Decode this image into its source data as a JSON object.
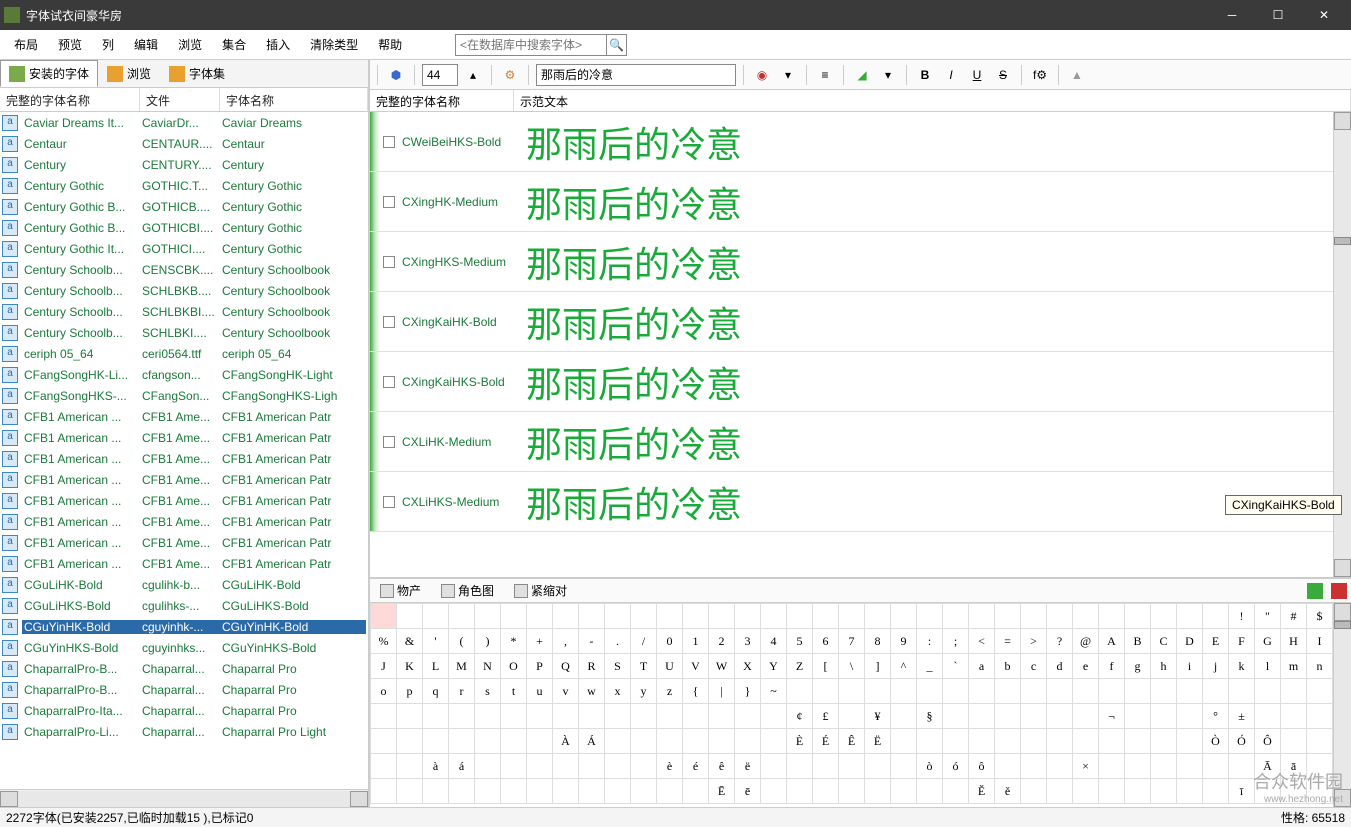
{
  "app": {
    "title": "字体试衣间豪华房"
  },
  "menu": [
    "布局",
    "预览",
    "列",
    "编辑",
    "浏览",
    "集合",
    "插入",
    "清除类型",
    "帮助"
  ],
  "search_placeholder": "<在数据库中搜索字体>",
  "left_tabs": [
    {
      "label": "安装的字体",
      "active": true
    },
    {
      "label": "浏览",
      "active": false
    },
    {
      "label": "字体集",
      "active": false
    }
  ],
  "left_headers": [
    "完整的字体名称",
    "文件",
    "字体名称"
  ],
  "font_rows": [
    {
      "name": "Caviar Dreams It...",
      "file": "CaviarDr...",
      "disp": "Caviar Dreams"
    },
    {
      "name": "Centaur",
      "file": "CENTAUR....",
      "disp": "Centaur"
    },
    {
      "name": "Century",
      "file": "CENTURY....",
      "disp": "Century"
    },
    {
      "name": "Century Gothic",
      "file": "GOTHIC.T...",
      "disp": "Century Gothic"
    },
    {
      "name": "Century Gothic B...",
      "file": "GOTHICB....",
      "disp": "Century Gothic"
    },
    {
      "name": "Century Gothic B...",
      "file": "GOTHICBI....",
      "disp": "Century Gothic"
    },
    {
      "name": "Century Gothic It...",
      "file": "GOTHICI....",
      "disp": "Century Gothic"
    },
    {
      "name": "Century Schoolb...",
      "file": "CENSCBK....",
      "disp": "Century Schoolbook"
    },
    {
      "name": "Century Schoolb...",
      "file": "SCHLBKB....",
      "disp": "Century Schoolbook"
    },
    {
      "name": "Century Schoolb...",
      "file": "SCHLBKBI....",
      "disp": "Century Schoolbook"
    },
    {
      "name": "Century Schoolb...",
      "file": "SCHLBKI....",
      "disp": "Century Schoolbook"
    },
    {
      "name": "ceriph 05_64",
      "file": "ceri0564.ttf",
      "disp": "ceriph 05_64"
    },
    {
      "name": "CFangSongHK-Li...",
      "file": "cfangson...",
      "disp": "CFangSongHK-Light"
    },
    {
      "name": "CFangSongHKS-...",
      "file": "CFangSon...",
      "disp": "CFangSongHKS-Ligh"
    },
    {
      "name": "CFB1 American ...",
      "file": "CFB1 Ame...",
      "disp": "CFB1 American Patr"
    },
    {
      "name": "CFB1 American ...",
      "file": "CFB1 Ame...",
      "disp": "CFB1 American Patr"
    },
    {
      "name": "CFB1 American ...",
      "file": "CFB1 Ame...",
      "disp": "CFB1 American Patr"
    },
    {
      "name": "CFB1 American ...",
      "file": "CFB1 Ame...",
      "disp": "CFB1 American Patr"
    },
    {
      "name": "CFB1 American ...",
      "file": "CFB1 Ame...",
      "disp": "CFB1 American Patr"
    },
    {
      "name": "CFB1 American ...",
      "file": "CFB1 Ame...",
      "disp": "CFB1 American Patr"
    },
    {
      "name": "CFB1 American ...",
      "file": "CFB1 Ame...",
      "disp": "CFB1 American Patr"
    },
    {
      "name": "CFB1 American ...",
      "file": "CFB1 Ame...",
      "disp": "CFB1 American Patr"
    },
    {
      "name": "CGuLiHK-Bold",
      "file": "cgulihk-b...",
      "disp": "CGuLiHK-Bold"
    },
    {
      "name": "CGuLiHKS-Bold",
      "file": "cgulihks-...",
      "disp": "CGuLiHKS-Bold"
    },
    {
      "name": "CGuYinHK-Bold",
      "file": "cguyinhk-...",
      "disp": "CGuYinHK-Bold",
      "selected": true
    },
    {
      "name": "CGuYinHKS-Bold",
      "file": "cguyinhks...",
      "disp": "CGuYinHKS-Bold"
    },
    {
      "name": "ChaparralPro-B...",
      "file": "Chaparral...",
      "disp": "Chaparral Pro"
    },
    {
      "name": "ChaparralPro-B...",
      "file": "Chaparral...",
      "disp": "Chaparral Pro"
    },
    {
      "name": "ChaparralPro-Ita...",
      "file": "Chaparral...",
      "disp": "Chaparral Pro"
    },
    {
      "name": "ChaparralPro-Li...",
      "file": "Chaparral...",
      "disp": "Chaparral Pro Light"
    }
  ],
  "toolbar": {
    "font_size": "44",
    "sample_text": "那雨后的冷意"
  },
  "preview_headers": [
    "完整的字体名称",
    "示范文本"
  ],
  "preview_rows": [
    {
      "name": "CWeiBeiHKS-Bold",
      "sample": "那雨后的冷意"
    },
    {
      "name": "CXingHK-Medium",
      "sample": "那雨后的冷意"
    },
    {
      "name": "CXingHKS-Medium",
      "sample": "那雨后的冷意"
    },
    {
      "name": "CXingKaiHK-Bold",
      "sample": "那雨后的冷意"
    },
    {
      "name": "CXingKaiHKS-Bold",
      "sample": "那雨后的冷意"
    },
    {
      "name": "CXLiHK-Medium",
      "sample": "那雨后的冷意"
    },
    {
      "name": "CXLiHKS-Medium",
      "sample": "那雨后的冷意"
    }
  ],
  "tooltip": "CXingKaiHKS-Bold",
  "bottom_tabs": [
    {
      "label": "物产"
    },
    {
      "label": "角色图"
    },
    {
      "label": "紧缩对"
    }
  ],
  "char_grid": [
    [
      "",
      "",
      "",
      "",
      "",
      "",
      "",
      "",
      "",
      "",
      "",
      "",
      "",
      "",
      "",
      "",
      "",
      "",
      "",
      "",
      "",
      "",
      "",
      "",
      "",
      "",
      "",
      "",
      "",
      "",
      "",
      "",
      "",
      "!",
      "\"",
      "#",
      "$"
    ],
    [
      "%",
      "&",
      "'",
      "(",
      ")",
      "*",
      "+",
      ",",
      "-",
      ".",
      "/",
      "0",
      "1",
      "2",
      "3",
      "4",
      "5",
      "6",
      "7",
      "8",
      "9",
      ":",
      ";",
      "<",
      "=",
      ">",
      "?",
      "@",
      "A",
      "B",
      "C",
      "D",
      "E",
      "F",
      "G",
      "H",
      "I"
    ],
    [
      "J",
      "K",
      "L",
      "M",
      "N",
      "O",
      "P",
      "Q",
      "R",
      "S",
      "T",
      "U",
      "V",
      "W",
      "X",
      "Y",
      "Z",
      "[",
      "\\",
      "]",
      "^",
      "_",
      "`",
      "a",
      "b",
      "c",
      "d",
      "e",
      "f",
      "g",
      "h",
      "i",
      "j",
      "k",
      "l",
      "m",
      "n"
    ],
    [
      "o",
      "p",
      "q",
      "r",
      "s",
      "t",
      "u",
      "v",
      "w",
      "x",
      "y",
      "z",
      "{",
      "|",
      "}",
      "~",
      "",
      "",
      "",
      "",
      "",
      "",
      "",
      "",
      "",
      "",
      "",
      "",
      "",
      "",
      "",
      "",
      "",
      "",
      "",
      "",
      ""
    ],
    [
      "",
      "",
      "",
      "",
      "",
      "",
      "",
      "",
      "",
      "",
      "",
      "",
      "",
      "",
      "",
      "",
      "¢",
      "£",
      "",
      "¥",
      "",
      "§",
      "",
      "",
      "",
      "",
      "",
      "",
      "¬",
      "",
      "",
      "",
      "°",
      "±",
      "",
      "",
      ""
    ],
    [
      "",
      "",
      "",
      "",
      "",
      "",
      "",
      "À",
      "Á",
      "",
      "",
      "",
      "",
      "",
      "",
      "",
      "È",
      "É",
      "Ê",
      "Ë",
      "",
      "",
      "",
      "",
      "",
      "",
      "",
      "",
      "",
      "",
      "",
      "",
      "Ò",
      "Ó",
      "Ô",
      "",
      ""
    ],
    [
      "",
      "",
      "à",
      "á",
      "",
      "",
      "",
      "",
      "",
      "",
      "",
      "è",
      "é",
      "ê",
      "ë",
      "",
      "",
      "",
      "",
      "",
      "",
      "ò",
      "ó",
      "ô",
      "",
      "",
      "",
      "×",
      "",
      "",
      "",
      "",
      "",
      "",
      "Ā",
      "ā",
      ""
    ],
    [
      "",
      "",
      "",
      "",
      "",
      "",
      "",
      "",
      "",
      "",
      "",
      "",
      "",
      "Ē",
      "ē",
      "",
      "",
      "",
      "",
      "",
      "",
      "",
      "",
      "Ě",
      "ě",
      "",
      "",
      "",
      "",
      "",
      "",
      "",
      "",
      "ī",
      "",
      "",
      ""
    ]
  ],
  "statusbar": {
    "left": "2272字体(已安装2257,已临时加载15 ),已标记0",
    "right": "性格: 65518"
  },
  "watermark": {
    "title": "合众软件园",
    "url": "www.hezhong.net"
  }
}
